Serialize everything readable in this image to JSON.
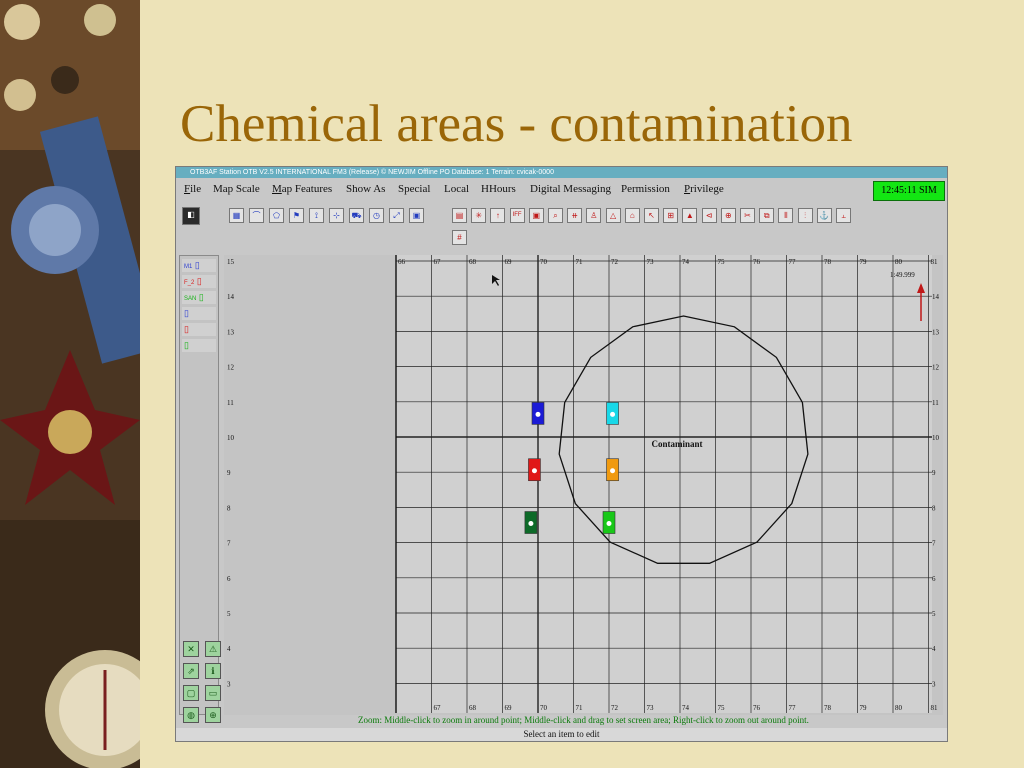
{
  "slide": {
    "title": "Chemical areas - contamination"
  },
  "window": {
    "title": "OTB3AF Station OTB V2.5 INTERNATIONAL FM3 (Release) © NEWJIM     Offline     PO Database: 1     Terrain: cvicak-0000",
    "clock": "12:45:11 SIM"
  },
  "menu": [
    {
      "label": "File",
      "underline": "F",
      "rest": "ile"
    },
    {
      "label": "Map Scale",
      "underline": "",
      "rest": "Map Scale"
    },
    {
      "label": "Map Features",
      "underline": "M",
      "rest": "ap Features"
    },
    {
      "label": "Show As",
      "underline": "",
      "rest": "Show As"
    },
    {
      "label": "Special",
      "underline": "",
      "rest": "Special"
    },
    {
      "label": "Local",
      "underline": "",
      "rest": "Local"
    },
    {
      "label": "HHours",
      "underline": "",
      "rest": "HHours"
    },
    {
      "label": "Digital Messaging",
      "underline": "",
      "rest": "Digital Messaging"
    },
    {
      "label": "Permission",
      "underline": "",
      "rest": "Permission"
    },
    {
      "label": "Privilege",
      "underline": "P",
      "rest": "rivilege"
    }
  ],
  "toolbar": {
    "blue": [
      "grid-icon",
      "line-icon",
      "polygon-icon",
      "flag-icon",
      "route-icon",
      "point-icon",
      "vehicle-icon",
      "clock-icon",
      "measure-icon",
      "window-icon"
    ],
    "red": [
      "unit-icon",
      "explosion-icon",
      "arrow-up-icon",
      "iff-icon",
      "target-icon",
      "zoom-icon",
      "bridge-icon",
      "bell-icon",
      "triangle-icon",
      "building-icon",
      "shovel-icon",
      "obstacle-icon",
      "mine-icon",
      "direct-fire-icon",
      "crosshair-icon",
      "cut-icon",
      "copy-icon",
      "minefield-icon",
      "barrier-icon",
      "anchor-icon",
      "rope-icon",
      "hash-icon"
    ],
    "iff_label": "IFF",
    "hash_label": "#"
  },
  "layers": [
    {
      "label": "M1",
      "color": "#2e3fd1"
    },
    {
      "label": "F_2",
      "color": "#d82020"
    },
    {
      "label": "SAN",
      "color": "#19b319"
    },
    {
      "label": "",
      "color": "#2e3fd1"
    },
    {
      "label": "",
      "color": "#d82020"
    },
    {
      "label": "",
      "color": "#19b319"
    }
  ],
  "map": {
    "x_ticks": [
      "66",
      "67",
      "68",
      "69",
      "70",
      "71",
      "72",
      "73",
      "74",
      "75",
      "76",
      "77",
      "78",
      "79",
      "80",
      "81"
    ],
    "y_ticks": [
      "15",
      "14",
      "13",
      "12",
      "11",
      "10",
      "9",
      "8",
      "7",
      "6",
      "5",
      "4",
      "3"
    ],
    "corner_time": "1:49.999",
    "area_label": "Contaminant",
    "units": [
      {
        "name": "blue-unit",
        "color": "#1b1bd6",
        "x": 70,
        "y": 10.5
      },
      {
        "name": "cyan-unit",
        "color": "#18d8e8",
        "x": 72.1,
        "y": 10.5
      },
      {
        "name": "red-unit",
        "color": "#e01818",
        "x": 69.9,
        "y": 8.9
      },
      {
        "name": "orange-unit",
        "color": "#f09a10",
        "x": 72.1,
        "y": 8.9
      },
      {
        "name": "darkgreen-unit",
        "color": "#0d6a28",
        "x": 69.8,
        "y": 7.4
      },
      {
        "name": "green-unit",
        "color": "#18c818",
        "x": 72.0,
        "y": 7.4
      }
    ]
  },
  "status": "Zoom: Middle-click to zoom in around point; Middle-click and drag to set screen area; Right-click to zoom out around point.",
  "footer": "Select an item to edit"
}
